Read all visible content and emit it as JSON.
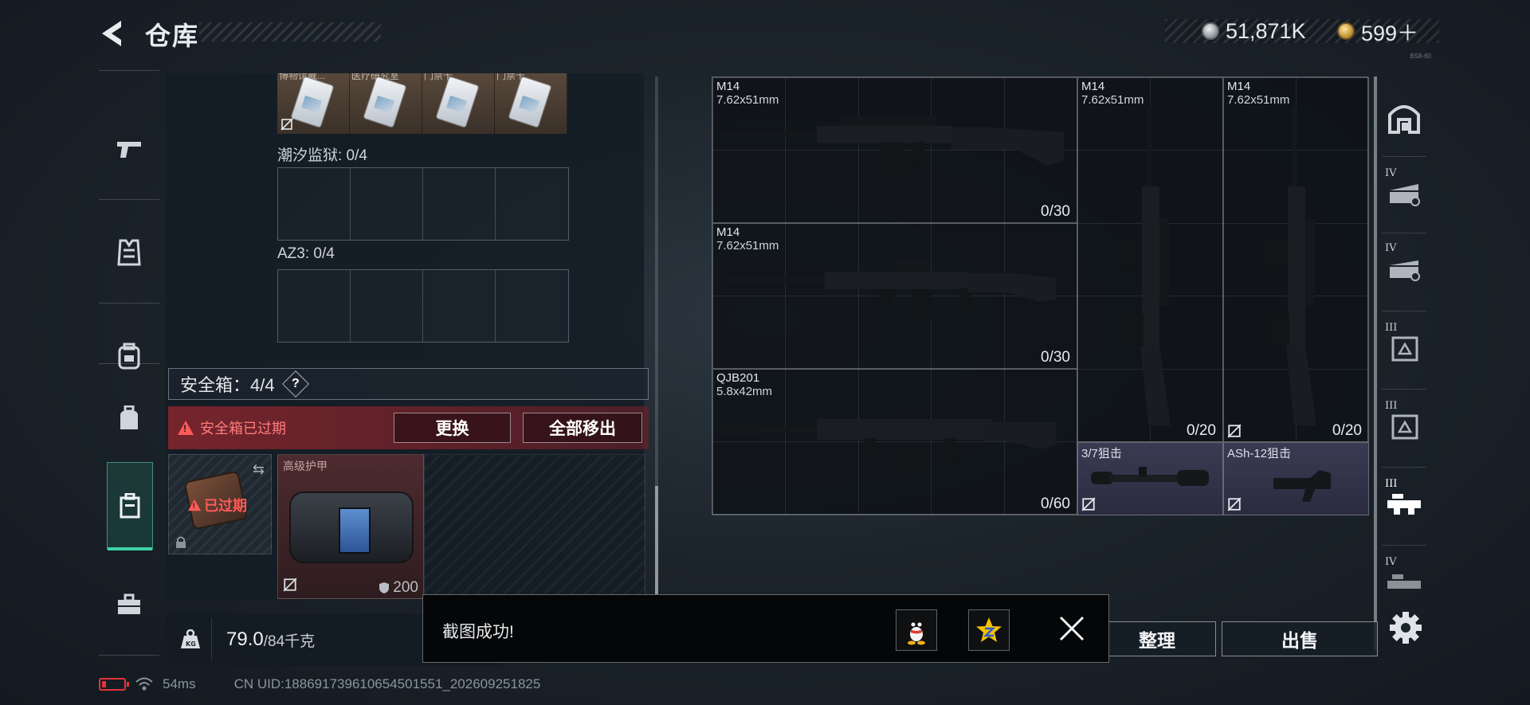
{
  "header": {
    "title": "仓库",
    "currency_silver": "51,871K",
    "currency_gold": "599＋",
    "tiny_code": "BS8-60"
  },
  "left_sidebar": {
    "items": [
      {
        "name": "pistol",
        "icon": "pistol-icon"
      },
      {
        "name": "vest",
        "icon": "vest-icon"
      },
      {
        "name": "backpack",
        "icon": "backpack-icon"
      },
      {
        "name": "bag",
        "icon": "bag-icon"
      },
      {
        "name": "safebox",
        "icon": "safebox-icon",
        "active": true
      },
      {
        "name": "toolbox",
        "icon": "toolbox-icon"
      }
    ]
  },
  "left_panel": {
    "top_items": [
      "博物馆藏...",
      "医疗研究室",
      "门禁卡",
      "门禁卡"
    ],
    "group1_label": "潮汐监狱: 0/4",
    "group2_label": "AZ3: 0/4",
    "safebox_label": "安全箱：4/4",
    "help": "?",
    "expired_label": "安全箱已过期",
    "replace_button": "更换",
    "move_all_button": "全部移出",
    "safebox_expired_badge": "已过期",
    "armor_name": "高级护甲",
    "armor_durability": "200"
  },
  "weight": {
    "icon_label": "KG",
    "current": "79.0",
    "capacity": "/84千克"
  },
  "weapons": [
    {
      "name": "M14",
      "caliber": "7.62x51mm",
      "ammo": "0/30"
    },
    {
      "name": "M14",
      "caliber": "7.62x51mm",
      "ammo": "0/30"
    },
    {
      "name": "QJB201",
      "caliber": "5.8x42mm",
      "ammo": "0/60"
    },
    {
      "name": "M14",
      "caliber": "7.62x51mm",
      "ammo": "0/20"
    },
    {
      "name": "M14",
      "caliber": "7.62x51mm",
      "ammo": "0/20"
    }
  ],
  "attachments": [
    {
      "name": "3/7狙击"
    },
    {
      "name": "ASh-12狙击"
    }
  ],
  "right_sidebar": {
    "tiers": [
      "IV",
      "IV",
      "III",
      "III",
      "III",
      "IV"
    ]
  },
  "buttons": {
    "sort": "整理",
    "sell": "出售"
  },
  "toast": {
    "text": "截图成功!"
  },
  "status": {
    "ping": "54ms",
    "uid": "CN UID:1886917396106545015​51_202609251825"
  },
  "colors": {
    "accent": "#3fd2a4",
    "danger": "#e0353b",
    "attachment_bg": "#34344c"
  }
}
